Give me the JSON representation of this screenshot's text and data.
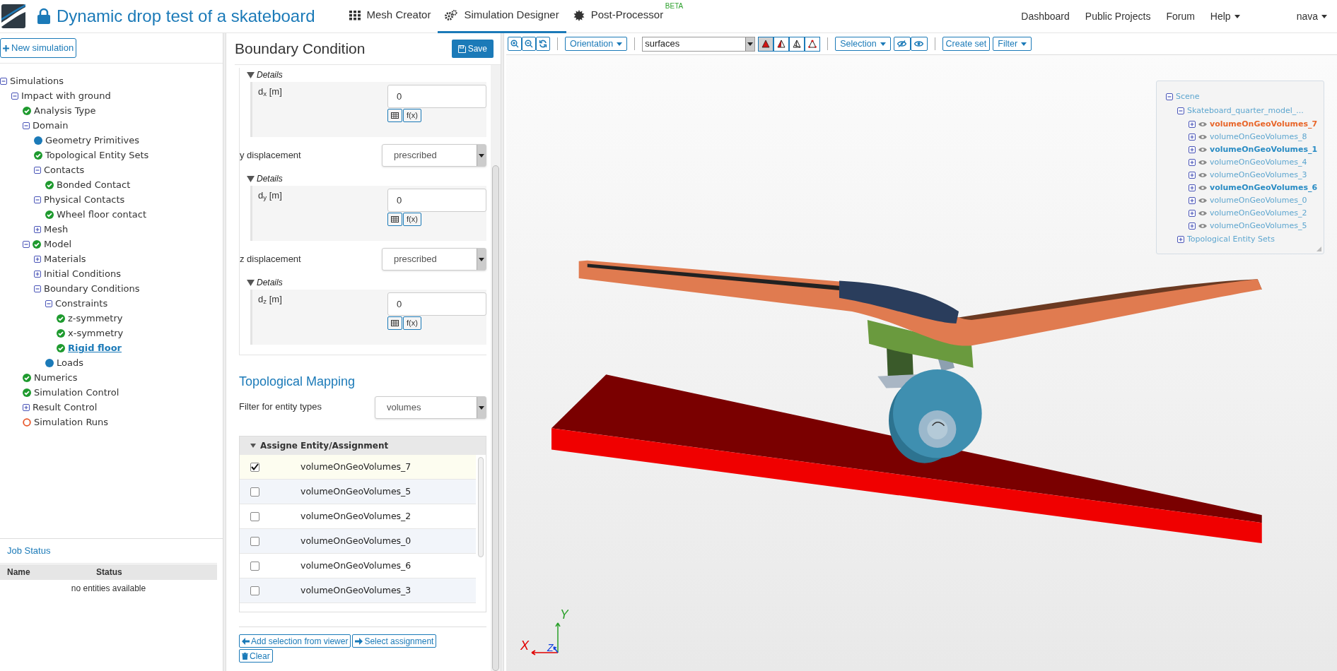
{
  "header": {
    "title": "Dynamic drop test of a skateboard",
    "nav": [
      {
        "label": "Mesh Creator",
        "kind": "grid",
        "selected": false
      },
      {
        "label": "Simulation Designer",
        "kind": "gears",
        "selected": true
      },
      {
        "label": "Post-Processor",
        "kind": "burst",
        "selected": false,
        "badge": "BETA"
      }
    ],
    "links": [
      {
        "label": "Dashboard",
        "dropdown": false
      },
      {
        "label": "Public Projects",
        "dropdown": false
      },
      {
        "label": "Forum",
        "dropdown": false
      },
      {
        "label": "Help",
        "dropdown": true
      },
      {
        "label": "nava",
        "dropdown": true
      }
    ]
  },
  "sidebar": {
    "new_button": "New simulation",
    "tree": [
      {
        "label": "Simulations",
        "expanded": true,
        "selected": false,
        "children": [
          {
            "label": "Impact with ground",
            "expanded": true,
            "selected": false,
            "children": [
              {
                "label": "Analysis Type",
                "kind": "check",
                "selected": false
              },
              {
                "label": "Domain",
                "expanded": true,
                "selected": false,
                "children": [
                  {
                    "label": "Geometry Primitives",
                    "kind": "dot",
                    "selected": false
                  },
                  {
                    "label": "Topological Entity Sets",
                    "kind": "check",
                    "selected": false
                  },
                  {
                    "label": "Contacts",
                    "expanded": true,
                    "selected": false,
                    "children": [
                      {
                        "label": "Bonded Contact",
                        "kind": "check",
                        "selected": false
                      }
                    ]
                  },
                  {
                    "label": "Physical Contacts",
                    "expanded": true,
                    "selected": false,
                    "children": [
                      {
                        "label": "Wheel floor contact",
                        "kind": "check",
                        "selected": false
                      }
                    ]
                  },
                  {
                    "label": "Mesh",
                    "expanded": false,
                    "selected": false
                  }
                ]
              },
              {
                "label": "Model",
                "expanded": true,
                "kind": "check",
                "selected": false,
                "children": [
                  {
                    "label": "Materials",
                    "expanded": false,
                    "selected": false
                  },
                  {
                    "label": "Initial Conditions",
                    "expanded": false,
                    "selected": false
                  },
                  {
                    "label": "Boundary Conditions",
                    "expanded": true,
                    "selected": false,
                    "children": [
                      {
                        "label": "Constraints",
                        "expanded": true,
                        "selected": false,
                        "children": [
                          {
                            "label": "z-symmetry",
                            "kind": "check",
                            "selected": false
                          },
                          {
                            "label": "x-symmetry",
                            "kind": "check",
                            "selected": false
                          },
                          {
                            "label": "Rigid floor",
                            "kind": "check",
                            "selected": true
                          }
                        ]
                      },
                      {
                        "label": "Loads",
                        "kind": "dot",
                        "selected": false
                      }
                    ]
                  }
                ]
              },
              {
                "label": "Numerics",
                "kind": "check",
                "selected": false
              },
              {
                "label": "Simulation Control",
                "kind": "check",
                "selected": false
              },
              {
                "label": "Result Control",
                "expanded": false,
                "selected": false
              },
              {
                "label": "Simulation Runs",
                "kind": "ring",
                "selected": false
              }
            ]
          }
        ]
      }
    ],
    "job_status": {
      "title": "Job Status",
      "columns": [
        "Name",
        "Status"
      ],
      "empty": "no entities available"
    }
  },
  "editor": {
    "title": "Boundary Condition",
    "save": "Save",
    "sections": [
      {
        "kind": "details",
        "label": "Details",
        "field": "d$_{x}$ [m]",
        "value": "0",
        "fx": "f(x)"
      },
      {
        "kind": "select",
        "label": "y displacement",
        "value": "prescribed"
      },
      {
        "kind": "details",
        "label": "Details",
        "field": "d$_{y}$ [m]",
        "value": "0",
        "fx": "f(x)"
      },
      {
        "kind": "select",
        "label": "z displacement",
        "value": "prescribed"
      },
      {
        "kind": "details",
        "label": "Details",
        "field": "d$_{z}$ [m]",
        "value": "0",
        "fx": "f(x)"
      }
    ]
  },
  "mapping": {
    "title": "Topological Mapping",
    "filter_label": "Filter for entity types",
    "filter_value": "volumes",
    "columns": [
      "Assigne",
      "Entity/Assignment"
    ],
    "rows": [
      {
        "name": "volumeOnGeoVolumes_7",
        "checked": true
      },
      {
        "name": "volumeOnGeoVolumes_5",
        "checked": false
      },
      {
        "name": "volumeOnGeoVolumes_2",
        "checked": false
      },
      {
        "name": "volumeOnGeoVolumes_0",
        "checked": false
      },
      {
        "name": "volumeOnGeoVolumes_6",
        "checked": false
      },
      {
        "name": "volumeOnGeoVolumes_3",
        "checked": false
      }
    ],
    "buttons": [
      {
        "label": "Add selection from viewer",
        "kind": "left"
      },
      {
        "label": "Select assignment",
        "kind": "right"
      },
      {
        "label": "Clear",
        "kind": "trash"
      }
    ]
  },
  "viewer": {
    "toolbar": {
      "orientation": "Orientation",
      "render_select": "surfaces",
      "render_modes": [
        {
          "kind": "solid",
          "selected": true
        },
        {
          "kind": "edges",
          "selected": false
        },
        {
          "kind": "wire",
          "selected": false
        },
        {
          "kind": "points",
          "selected": false
        }
      ],
      "selection": "Selection",
      "create_set": "Create set",
      "filter": "Filter"
    },
    "scene": {
      "root": "Scene",
      "model": "Skateboard_quarter_model_...",
      "items": [
        {
          "label": "volumeOnGeoVolumes_7",
          "kind": "selected"
        },
        {
          "label": "volumeOnGeoVolumes_8",
          "kind": "normal"
        },
        {
          "label": "volumeOnGeoVolumes_1",
          "kind": "bold"
        },
        {
          "label": "volumeOnGeoVolumes_4",
          "kind": "normal"
        },
        {
          "label": "volumeOnGeoVolumes_3",
          "kind": "normal"
        },
        {
          "label": "volumeOnGeoVolumes_6",
          "kind": "bold"
        },
        {
          "label": "volumeOnGeoVolumes_0",
          "kind": "normal"
        },
        {
          "label": "volumeOnGeoVolumes_2",
          "kind": "normal"
        },
        {
          "label": "volumeOnGeoVolumes_5",
          "kind": "normal"
        }
      ],
      "sets": "Topological Entity Sets"
    },
    "axes": {
      "x": "X",
      "y": "Y",
      "z": "Z"
    }
  }
}
